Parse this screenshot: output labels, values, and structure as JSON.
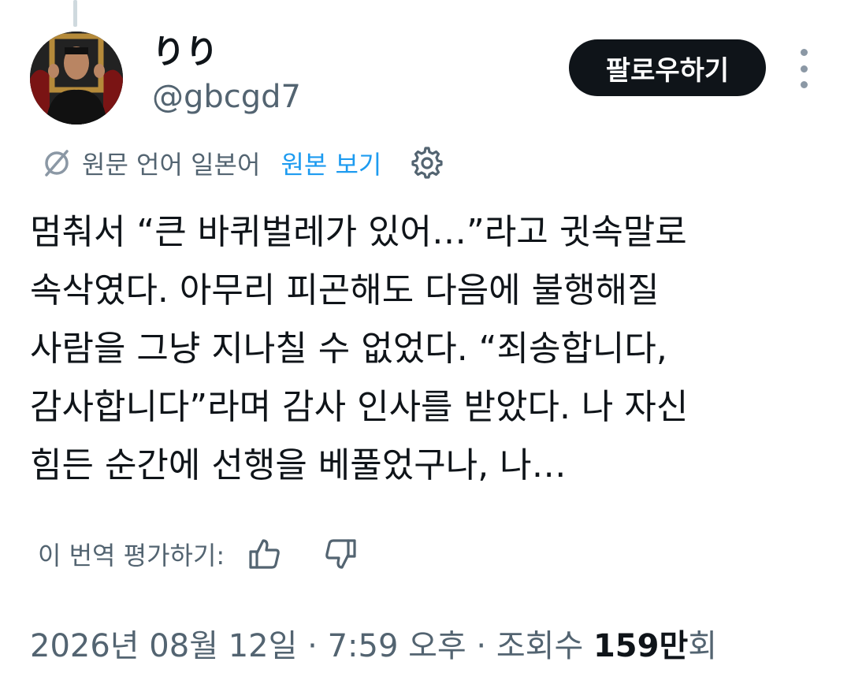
{
  "author": {
    "display_name": "りり",
    "handle": "@gbcgd7"
  },
  "follow_button": {
    "label": "팔로우하기"
  },
  "more_button": {
    "icon": "more-vertical-icon"
  },
  "translation_bar": {
    "icon": "translate-icon",
    "source_language_text": "원문 언어 일본어",
    "view_original_label": "원본 보기",
    "settings_icon": "gear-icon",
    "link_color": "#1d9bf0"
  },
  "tweet": {
    "lines": [
      "멈춰서 “큰 바퀴벌레가 있어…”라고 귓속말로",
      "속삭였다. 아무리 피곤해도 다음에 불행해질",
      "사람을 그냥 지나칠 수 없었다. “죄송합니다,",
      "감사합니다”라며 감사 인사를 받았다. 나 자신",
      "힘든 순간에 선행을 베풀었구나, 나…"
    ]
  },
  "rating": {
    "label": "이 번역 평가하기:",
    "thumbs_up_icon": "thumbs-up-icon",
    "thumbs_down_icon": "thumbs-down-icon"
  },
  "meta": {
    "date_time": "2026년 08월 12일 · 7:59 오후 · 조회수 ",
    "views_number": "159만",
    "views_suffix": "회"
  },
  "colors": {
    "text_primary": "#0f1419",
    "text_secondary": "#536471",
    "button_bg": "#0f1419"
  }
}
